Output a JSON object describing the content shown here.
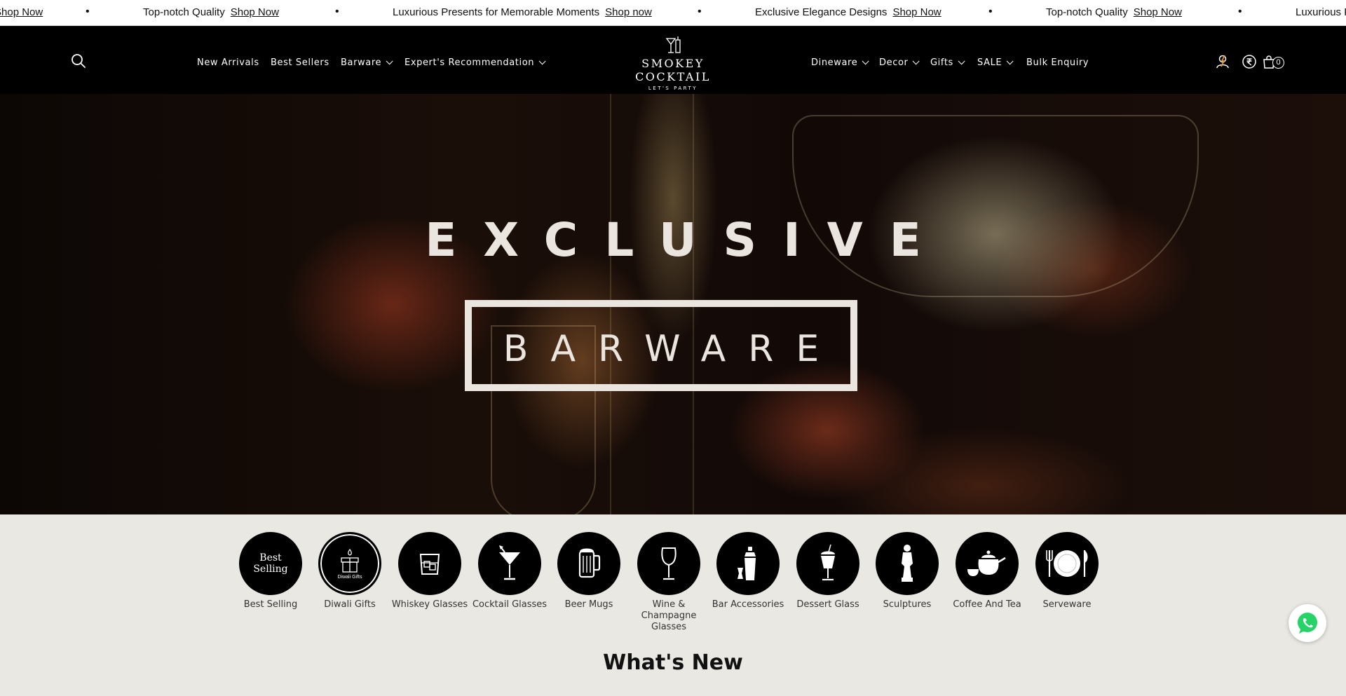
{
  "announcement": {
    "items": [
      {
        "text": "",
        "link": "Shop Now"
      },
      {
        "text": "Top-notch Quality",
        "link": "Shop Now"
      },
      {
        "text": "Luxurious Presents for Memorable Moments",
        "link": "Shop now"
      },
      {
        "text": "Exclusive Elegance Designs",
        "link": "Shop Now"
      },
      {
        "text": "Top-notch Quality",
        "link": "Shop Now"
      },
      {
        "text": "Luxurious P",
        "link": ""
      }
    ],
    "separator": "•"
  },
  "header": {
    "nav_left": [
      {
        "label": "New Arrivals",
        "dropdown": false
      },
      {
        "label": "Best Sellers",
        "dropdown": false
      },
      {
        "label": "Barware",
        "dropdown": true
      },
      {
        "label": "Expert's Recommendation",
        "dropdown": true
      }
    ],
    "nav_right": [
      {
        "label": "Dineware",
        "dropdown": true
      },
      {
        "label": "Decor",
        "dropdown": true
      },
      {
        "label": "Gifts",
        "dropdown": true
      },
      {
        "label": "SALE",
        "dropdown": true
      },
      {
        "label": "Bulk Enquiry",
        "dropdown": false
      }
    ],
    "logo": {
      "name": "SMOKEY COCKTAIL",
      "tagline": "LET'S PARTY"
    },
    "cart_count": "0",
    "icons": [
      "search-icon",
      "user-icon",
      "currency-rupee-icon",
      "cart-icon"
    ]
  },
  "hero": {
    "title": "EXCLUSIVE",
    "subtitle": "BARWARE"
  },
  "categories": [
    {
      "label": "Best Selling",
      "icon_text": "Best Selling",
      "icon": "best-selling-icon"
    },
    {
      "label": "Diwali Gifts",
      "icon_text": "Diwali Gifts",
      "icon": "gift-box-icon"
    },
    {
      "label": "Whiskey Glasses",
      "icon": "whiskey-glass-icon"
    },
    {
      "label": "Cocktail Glasses",
      "icon": "cocktail-glass-icon"
    },
    {
      "label": "Beer Mugs",
      "icon": "beer-mug-icon"
    },
    {
      "label": "Wine & Champagne Glasses",
      "icon": "wine-glass-icon"
    },
    {
      "label": "Bar Accessories",
      "icon": "shaker-icon"
    },
    {
      "label": "Dessert Glass",
      "icon": "dessert-glass-icon"
    },
    {
      "label": "Sculptures",
      "icon": "sculpture-icon"
    },
    {
      "label": "Coffee And Tea",
      "icon": "teapot-icon"
    },
    {
      "label": "Serveware",
      "icon": "plate-icon"
    }
  ],
  "section": {
    "title": "What's New"
  },
  "colors": {
    "header_bg": "#000000",
    "page_bg": "#e9e8e3",
    "whatsapp": "#25d366"
  }
}
